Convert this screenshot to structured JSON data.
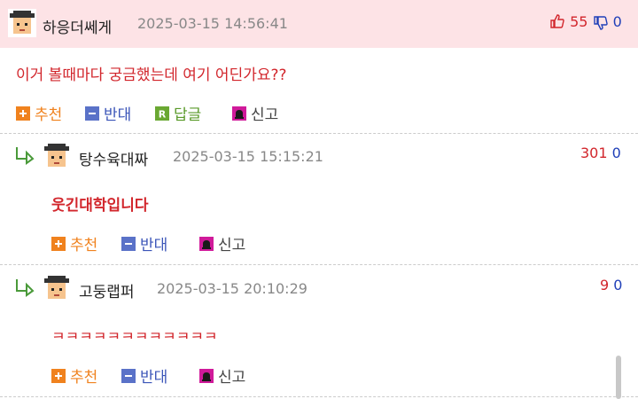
{
  "comments": [
    {
      "nickname": "하응더쎄게",
      "timestamp": "2025-03-15 14:56:41",
      "text": "이거 볼때마다 궁금했는데 여기 어딘가요??",
      "upvotes": "55",
      "downvotes": "0",
      "actions": {
        "recommend": "추천",
        "oppose": "반대",
        "reply": "답글",
        "report": "신고"
      }
    },
    {
      "nickname": "탕수육대짜",
      "timestamp": "2025-03-15 15:15:21",
      "text": "웃긴대학입니다",
      "upvotes": "301",
      "downvotes": "0",
      "actions": {
        "recommend": "추천",
        "oppose": "반대",
        "report": "신고"
      }
    },
    {
      "nickname": "고둥랩퍼",
      "timestamp": "2025-03-15 20:10:29",
      "text": "ㅋㅋㅋㅋㅋㅋㅋㅋㅋㅋㅋㅋ",
      "upvotes": "9",
      "downvotes": "0",
      "actions": {
        "recommend": "추천",
        "oppose": "반대",
        "report": "신고"
      }
    }
  ],
  "icons": {
    "recommend": "plus-square-icon",
    "oppose": "minus-square-icon",
    "reply": "r-square-icon",
    "report": "siren-icon",
    "thumbs_up": "thumbs-up-icon",
    "thumbs_down": "thumbs-down-icon",
    "reply_arrow": "reply-arrow-icon"
  },
  "colors": {
    "header_bg": "#fde3e6",
    "text_red": "#d2262c",
    "downvote_blue": "#1f3fb8",
    "recommend_orange": "#f0821e",
    "oppose_blue": "#5a72c8",
    "reply_green": "#6aa832",
    "report_magenta": "#d01a9a"
  }
}
